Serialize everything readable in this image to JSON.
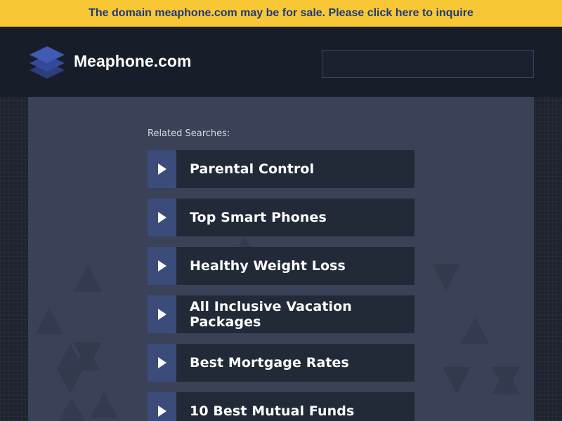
{
  "topbar": {
    "text": "The domain meaphone.com may be for sale. Please click here to inquire"
  },
  "header": {
    "brand": "Meaphone.com",
    "logo_icon": "stacked-layers-icon"
  },
  "search": {
    "value": ""
  },
  "related": {
    "label": "Related Searches:",
    "items": [
      {
        "label": "Parental Control"
      },
      {
        "label": "Top Smart Phones"
      },
      {
        "label": "Healthy Weight Loss"
      },
      {
        "label": "All Inclusive Vacation Packages"
      },
      {
        "label": "Best Mortgage Rates"
      },
      {
        "label": "10 Best Mutual Funds"
      }
    ]
  },
  "colors": {
    "topbar_bg": "#f8c735",
    "topbar_text": "#1f3a7a",
    "header_bg": "#181e29",
    "main_bg": "#3a4257",
    "arrow_bg": "#3b4b7a",
    "item_bg": "#232a37"
  }
}
